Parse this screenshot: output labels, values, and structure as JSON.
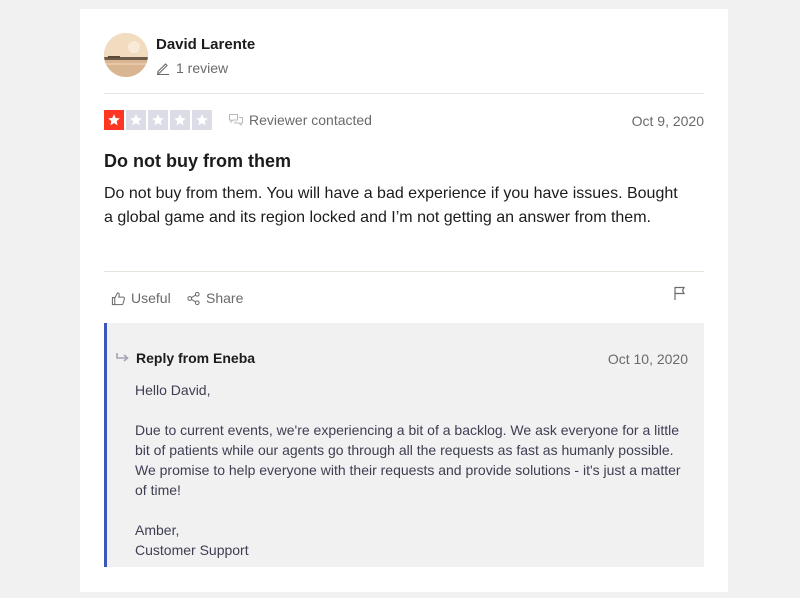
{
  "reviewer": {
    "name": "David Larente",
    "review_count": "1 review"
  },
  "review": {
    "rating": 1,
    "max_rating": 5,
    "status": "Reviewer contacted",
    "date": "Oct 9, 2020",
    "title": "Do not buy from them",
    "body": "Do not buy from them. You will have a bad experience if you have issues. Bought a global game and its region locked and I’m not getting an answer from them."
  },
  "actions": {
    "useful_label": "Useful",
    "share_label": "Share"
  },
  "reply": {
    "header": "Reply from Eneba",
    "date": "Oct 10, 2020",
    "greeting": "Hello David,",
    "message": "Due to current events, we're experiencing a bit of a backlog. We ask everyone for a little bit of patients while our agents go through all the requests as fast as humanly possible. We promise to help everyone with their requests and provide solutions - it's just a matter of time!",
    "signoff_name": "Amber,",
    "signoff_title": "Customer Support"
  },
  "colors": {
    "star_filled": "#ff3722",
    "star_empty": "#dcdce6",
    "reply_accent": "#3c57bc"
  },
  "icons": [
    "pen-icon",
    "chat-icon",
    "star-icon",
    "thumbs-up-icon",
    "share-icon",
    "flag-icon",
    "reply-arrow-icon"
  ]
}
